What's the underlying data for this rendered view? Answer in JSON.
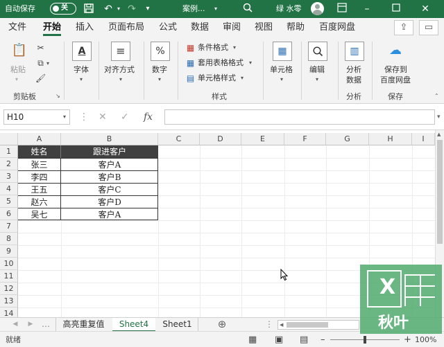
{
  "titlebar": {
    "autosave_label": "自动保存",
    "autosave_state": "关",
    "filename": "案例...",
    "user": "绿 水零",
    "icons": [
      "save-icon",
      "undo-icon",
      "redo-icon",
      "more-icon",
      "search-icon",
      "minimize-icon",
      "maximize-icon",
      "close-icon"
    ]
  },
  "menu": {
    "tabs": [
      "文件",
      "开始",
      "插入",
      "页面布局",
      "公式",
      "数据",
      "审阅",
      "视图",
      "帮助",
      "百度网盘"
    ],
    "active_tab": "开始"
  },
  "ribbon": {
    "clipboard": {
      "paste": "粘贴",
      "group": "剪贴板"
    },
    "font": {
      "label": "字体"
    },
    "align": {
      "label": "对齐方式"
    },
    "number": {
      "label": "数字",
      "icon_text": "%"
    },
    "styles": {
      "conditional": "条件格式",
      "table_format": "套用表格格式",
      "cell_style": "单元格样式",
      "group": "样式"
    },
    "cells": {
      "label": "单元格"
    },
    "edit": {
      "label": "编辑"
    },
    "analysis": {
      "label": "分析数据",
      "label1": "分析",
      "label2": "数据",
      "group": "分析"
    },
    "save": {
      "label1": "保存到",
      "label2": "百度网盘",
      "group": "保存"
    }
  },
  "formula_bar": {
    "name_box": "H10",
    "fx": "fx",
    "value": ""
  },
  "sheet": {
    "columns": [
      "A",
      "B",
      "C",
      "D",
      "E",
      "F",
      "G",
      "H",
      "I"
    ],
    "rows": [
      "1",
      "2",
      "3",
      "4",
      "5",
      "6",
      "7",
      "8",
      "9",
      "10",
      "11",
      "12",
      "13",
      "14"
    ],
    "header": [
      "姓名",
      "跟进客户"
    ],
    "data": [
      [
        "张三",
        "客户A"
      ],
      [
        "李四",
        "客户B"
      ],
      [
        "王五",
        "客户C"
      ],
      [
        "赵六",
        "客户D"
      ],
      [
        "吴七",
        "客户A"
      ]
    ]
  },
  "sheet_tabs": {
    "tabs": [
      "高亮重复值",
      "Sheet4",
      "Sheet1"
    ],
    "active": "Sheet4"
  },
  "status": {
    "text": "就绪",
    "zoom": "100%"
  },
  "logo": {
    "letter": "X",
    "text": "秋叶"
  },
  "colors": {
    "excel_green": "#217346",
    "header_fill": "#404040"
  }
}
